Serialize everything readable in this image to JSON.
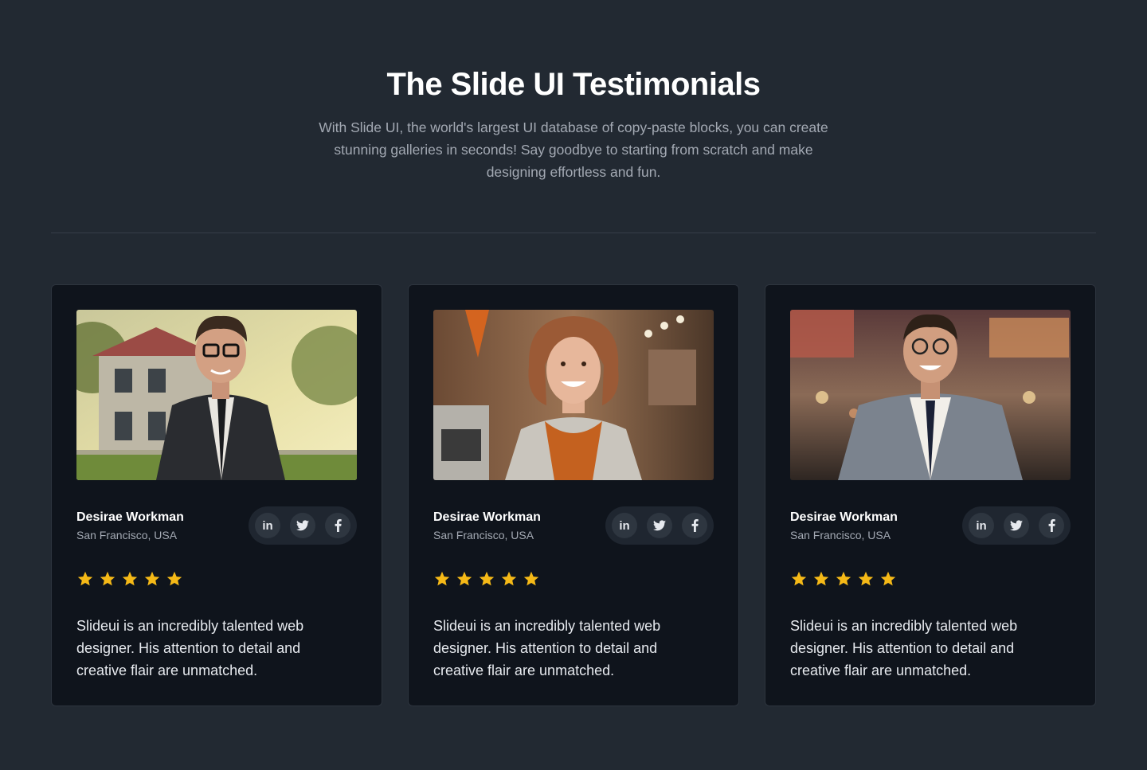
{
  "header": {
    "title": "The Slide UI Testimonials",
    "subtitle": "With Slide UI, the world's largest UI database of copy-paste blocks, you can create stunning galleries in seconds! Say goodbye to starting from scratch and make designing effortless and fun."
  },
  "testimonials": [
    {
      "name": "Desirae Workman",
      "location": "San Francisco, USA",
      "rating": 5,
      "quote": "Slideui is an incredibly talented web designer. His attention to detail and creative flair are unmatched.",
      "social": {
        "linkedin": "in"
      }
    },
    {
      "name": "Desirae Workman",
      "location": "San Francisco, USA",
      "rating": 5,
      "quote": "Slideui is an incredibly talented web designer. His attention to detail and creative flair are unmatched.",
      "social": {
        "linkedin": "in"
      }
    },
    {
      "name": "Desirae Workman",
      "location": "San Francisco, USA",
      "rating": 5,
      "quote": "Slideui is an incredibly talented web designer. His attention to detail and creative flair are unmatched.",
      "social": {
        "linkedin": "in"
      }
    }
  ],
  "icons": {
    "linkedin": "linkedin-icon",
    "twitter": "twitter-icon",
    "facebook": "facebook-icon",
    "star": "star-icon"
  },
  "colors": {
    "background": "#222932",
    "card": "#0f141c",
    "star": "#f5b917",
    "text_primary": "#ffffff",
    "text_muted": "#a3a9b3"
  }
}
